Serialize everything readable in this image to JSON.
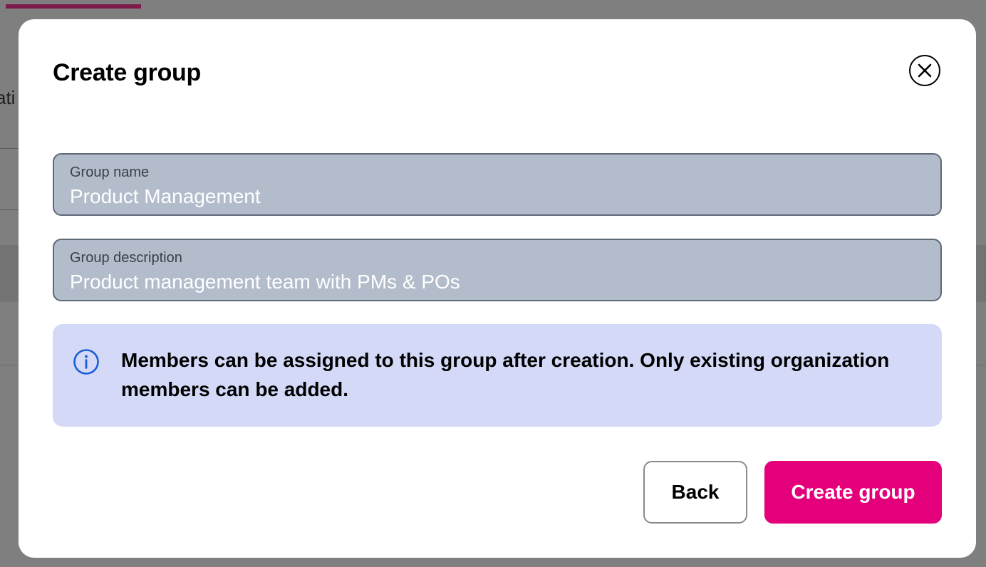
{
  "background": {
    "partial_text": "ati"
  },
  "modal": {
    "title": "Create group",
    "close_icon": "close-icon",
    "fields": {
      "group_name": {
        "label": "Group name",
        "value": "Product Management"
      },
      "group_description": {
        "label": "Group description",
        "value": "Product management team with PMs & POs"
      }
    },
    "info": {
      "icon": "info-icon",
      "text": "Members can be assigned to this group after creation. Only existing organization members can be added."
    },
    "buttons": {
      "back_label": "Back",
      "create_label": "Create group"
    }
  },
  "colors": {
    "backdrop": "#7f7f7f",
    "primary": "#e4007a",
    "field_bg": "#b2bccb",
    "info_bg": "#d3d9f7",
    "info_icon": "#1a5fd6"
  }
}
